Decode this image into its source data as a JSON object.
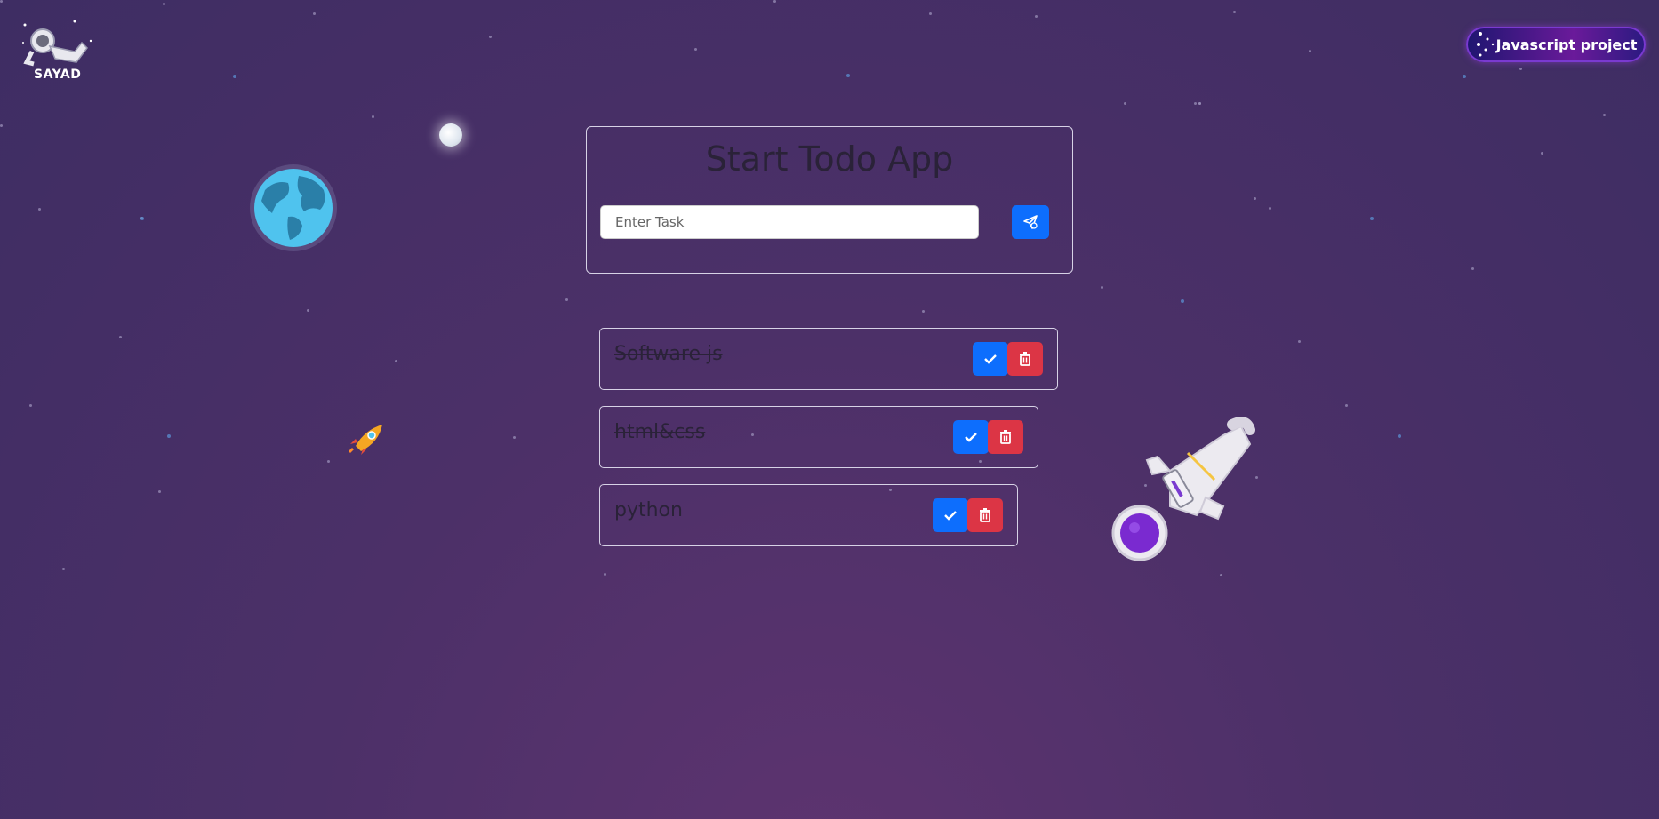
{
  "logo": {
    "text": "SAYAD"
  },
  "header": {
    "project_button_label": "Javascript project"
  },
  "todo_card": {
    "title": "Start Todo App",
    "input_placeholder": "Enter Task",
    "input_value": ""
  },
  "tasks": [
    {
      "text": "Software js",
      "completed": true
    },
    {
      "text": "html&css",
      "completed": true
    },
    {
      "text": "python",
      "completed": false
    }
  ],
  "colors": {
    "primary": "#0d6efd",
    "danger": "#dc3545",
    "background": "#44306a"
  },
  "icons": {
    "send": "send-icon",
    "check": "check-icon",
    "delete": "trash-icon",
    "decor": [
      "astronaut-logo-icon",
      "moon-icon",
      "earth-icon",
      "rocket-icon",
      "astronaut-icon"
    ]
  }
}
